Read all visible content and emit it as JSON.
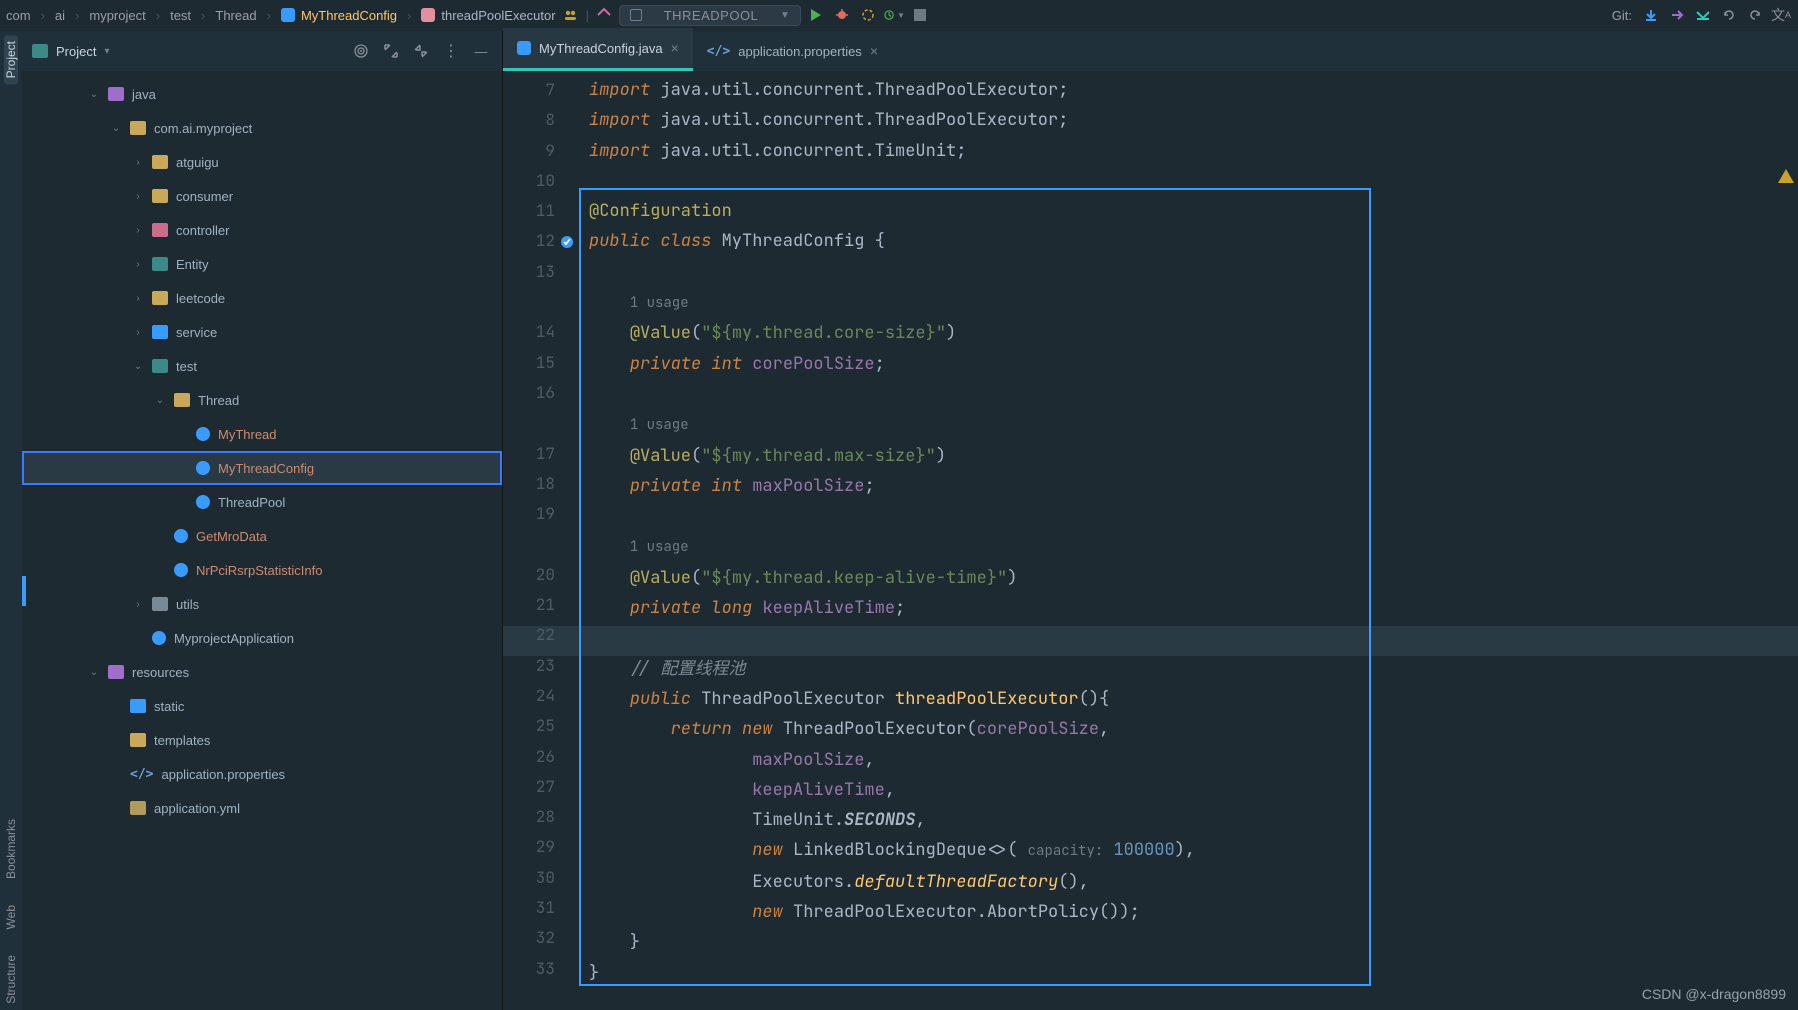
{
  "breadcrumb": {
    "items": [
      "com",
      "ai",
      "myproject",
      "test",
      "Thread",
      "MyThreadConfig",
      "threadPoolExecutor"
    ]
  },
  "run_config": {
    "label": "THREADPOOL"
  },
  "git_label": "Git:",
  "sidebar_strip": {
    "project": "Project",
    "bookmarks": "Bookmarks",
    "web": "Web",
    "structure": "Structure"
  },
  "project_panel": {
    "title": "Project",
    "tree": [
      {
        "d": 3,
        "exp": "v",
        "ic": "fi-purp",
        "lbl": "java",
        "git": false
      },
      {
        "d": 4,
        "exp": "v",
        "ic": "fi-yellow",
        "lbl": "com.ai.myproject",
        "git": false
      },
      {
        "d": 5,
        "exp": ">",
        "ic": "fi-yellow",
        "lbl": "atguigu",
        "git": false
      },
      {
        "d": 5,
        "exp": ">",
        "ic": "fi-yellow",
        "lbl": "consumer",
        "git": false
      },
      {
        "d": 5,
        "exp": ">",
        "ic": "fi-pink",
        "lbl": "controller",
        "git": false
      },
      {
        "d": 5,
        "exp": ">",
        "ic": "fi-teal",
        "lbl": "Entity",
        "git": false
      },
      {
        "d": 5,
        "exp": ">",
        "ic": "fi-yellow",
        "lbl": "leetcode",
        "git": false
      },
      {
        "d": 5,
        "exp": ">",
        "ic": "fi-blue",
        "lbl": "service",
        "git": false
      },
      {
        "d": 5,
        "exp": "v",
        "ic": "fi-teal",
        "lbl": "test",
        "git": false
      },
      {
        "d": 6,
        "exp": "v",
        "ic": "fi-yellow",
        "lbl": "Thread",
        "git": false
      },
      {
        "d": 7,
        "exp": "",
        "ic": "fi-class",
        "lbl": "MyThread",
        "git": true
      },
      {
        "d": 7,
        "exp": "",
        "ic": "fi-class",
        "lbl": "MyThreadConfig",
        "git": true,
        "sel": true
      },
      {
        "d": 7,
        "exp": "",
        "ic": "fi-class",
        "lbl": "ThreadPool",
        "git": false
      },
      {
        "d": 6,
        "exp": "",
        "ic": "fi-class",
        "lbl": "GetMroData",
        "git": true
      },
      {
        "d": 6,
        "exp": "",
        "ic": "fi-class",
        "lbl": "NrPciRsrpStatisticInfo",
        "git": true
      },
      {
        "d": 5,
        "exp": ">",
        "ic": "fi-grey",
        "lbl": "utils",
        "git": false
      },
      {
        "d": 5,
        "exp": "",
        "ic": "fi-class",
        "lbl": "MyprojectApplication",
        "git": false
      },
      {
        "d": 3,
        "exp": "v",
        "ic": "fi-purp",
        "lbl": "resources",
        "git": false
      },
      {
        "d": 4,
        "exp": "",
        "ic": "fi-blue",
        "lbl": "static",
        "git": false
      },
      {
        "d": 4,
        "exp": "",
        "ic": "fi-yellow",
        "lbl": "templates",
        "git": false
      },
      {
        "d": 4,
        "exp": "",
        "ic": "",
        "lbl": "application.properties",
        "git": false,
        "xml": true
      },
      {
        "d": 4,
        "exp": "",
        "ic": "fi-yaml",
        "lbl": "application.yml",
        "git": false
      }
    ]
  },
  "tabs": [
    {
      "label": "MyThreadConfig.java",
      "icon": "ti-j",
      "active": true
    },
    {
      "label": "application.properties",
      "icon": "xml",
      "active": false
    }
  ],
  "line_start": 7,
  "usage_label": "1 usage",
  "code": {
    "l7": "import java.util.concurrent.ThreadPoolExecutor;",
    "l8": "import java.util.concurrent.ThreadPoolExecutor;",
    "l9": "import java.util.concurrent.TimeUnit;",
    "ann_cfg": "@Configuration",
    "cls_decl_pub": "public",
    "cls_decl_class": "class",
    "cls_name": "MyThreadConfig",
    "v1": "@Value",
    "v1s": "\"${my.thread.core-size}\"",
    "p1a": "private",
    "p1b": "int",
    "p1c": "corePoolSize",
    "v2": "@Value",
    "v2s": "\"${my.thread.max-size}\"",
    "p2a": "private",
    "p2b": "int",
    "p2c": "maxPoolSize",
    "v3": "@Value",
    "v3s": "\"${my.thread.keep-alive-time}\"",
    "p3a": "private",
    "p3b": "long",
    "p3c": "keepAliveTime",
    "cmt": "// 配置线程池",
    "m_pub": "public",
    "m_ret": "ThreadPoolExecutor",
    "m_name": "threadPoolExecutor",
    "ret": "return",
    "new": "new",
    "tpe": "ThreadPoolExecutor",
    "arg1": "corePoolSize",
    "arg2": "maxPoolSize",
    "arg3": "keepAliveTime",
    "tu": "TimeUnit",
    "sec": "SECONDS",
    "lbd": "LinkedBlockingDeque",
    "cap_lbl": "capacity:",
    "cap_v": "100000",
    "exec": "Executors",
    "dtf": "defaultThreadFactory",
    "abort": "AbortPolicy"
  },
  "watermark": "CSDN @x-dragon8899"
}
